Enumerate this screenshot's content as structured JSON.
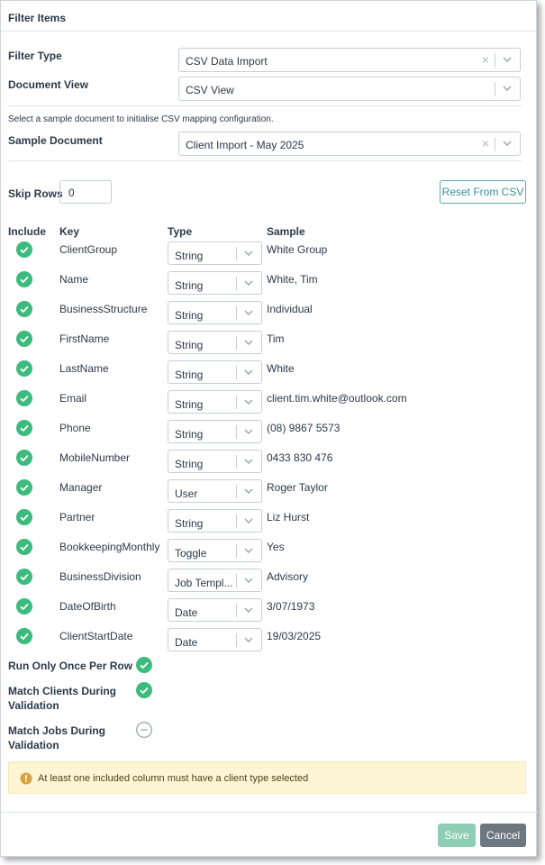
{
  "dialog": {
    "title": "Filter Items"
  },
  "filter_type": {
    "label": "Filter Type",
    "value": "CSV Data Import"
  },
  "document_view": {
    "label": "Document View",
    "value": "CSV View"
  },
  "note": "Select a sample document to initialise CSV mapping configuration.",
  "sample_document": {
    "label": "Sample Document",
    "value": "Client Import - May 2025"
  },
  "skip_rows": {
    "label": "Skip Rows",
    "value": "0"
  },
  "reset_button": "Reset From CSV",
  "table": {
    "headers": {
      "include": "Include",
      "key": "Key",
      "type": "Type",
      "sample": "Sample"
    },
    "rows": [
      {
        "key": "ClientGroup",
        "type": "String",
        "sample": "White Group"
      },
      {
        "key": "Name",
        "type": "String",
        "sample": "White, Tim"
      },
      {
        "key": "BusinessStructure",
        "type": "String",
        "sample": "Individual"
      },
      {
        "key": "FirstName",
        "type": "String",
        "sample": "Tim"
      },
      {
        "key": "LastName",
        "type": "String",
        "sample": "White"
      },
      {
        "key": "Email",
        "type": "String",
        "sample": "client.tim.white@outlook.com"
      },
      {
        "key": "Phone",
        "type": "String",
        "sample": "(08) 9867 5573"
      },
      {
        "key": "MobileNumber",
        "type": "String",
        "sample": "0433 830 476"
      },
      {
        "key": "Manager",
        "type": "User",
        "sample": "Roger Taylor"
      },
      {
        "key": "Partner",
        "type": "String",
        "sample": "Liz Hurst"
      },
      {
        "key": "BookkeepingMonthly",
        "type": "Toggle",
        "sample": "Yes"
      },
      {
        "key": "BusinessDivision",
        "type": "Job Templ...",
        "sample": "Advisory"
      },
      {
        "key": "DateOfBirth",
        "type": "Date",
        "sample": "3/07/1973"
      },
      {
        "key": "ClientStartDate",
        "type": "Date",
        "sample": "19/03/2025"
      }
    ]
  },
  "options": {
    "run_once": {
      "label": "Run Only Once Per Row",
      "state": "checked"
    },
    "match_clients": {
      "label_line1": "Match Clients During",
      "label_line2": "Validation",
      "state": "checked"
    },
    "match_jobs": {
      "label_line1": "Match Jobs During",
      "label_line2": "Validation",
      "state": "unchecked"
    }
  },
  "warning": "At least one included column must have a client type selected",
  "buttons": {
    "save": "Save",
    "cancel": "Cancel"
  },
  "colors": {
    "check": "#3dbb7d",
    "accent": "#3d8d9a",
    "warning_bg": "#fdf5d3",
    "save": "#8fcdb6",
    "cancel": "#6c7780"
  },
  "icons": {
    "check": "check-circle-icon",
    "unchecked": "minus-circle-icon",
    "clear": "x-icon",
    "dropdown": "chevron-down-icon",
    "warning": "exclamation-circle-icon"
  }
}
